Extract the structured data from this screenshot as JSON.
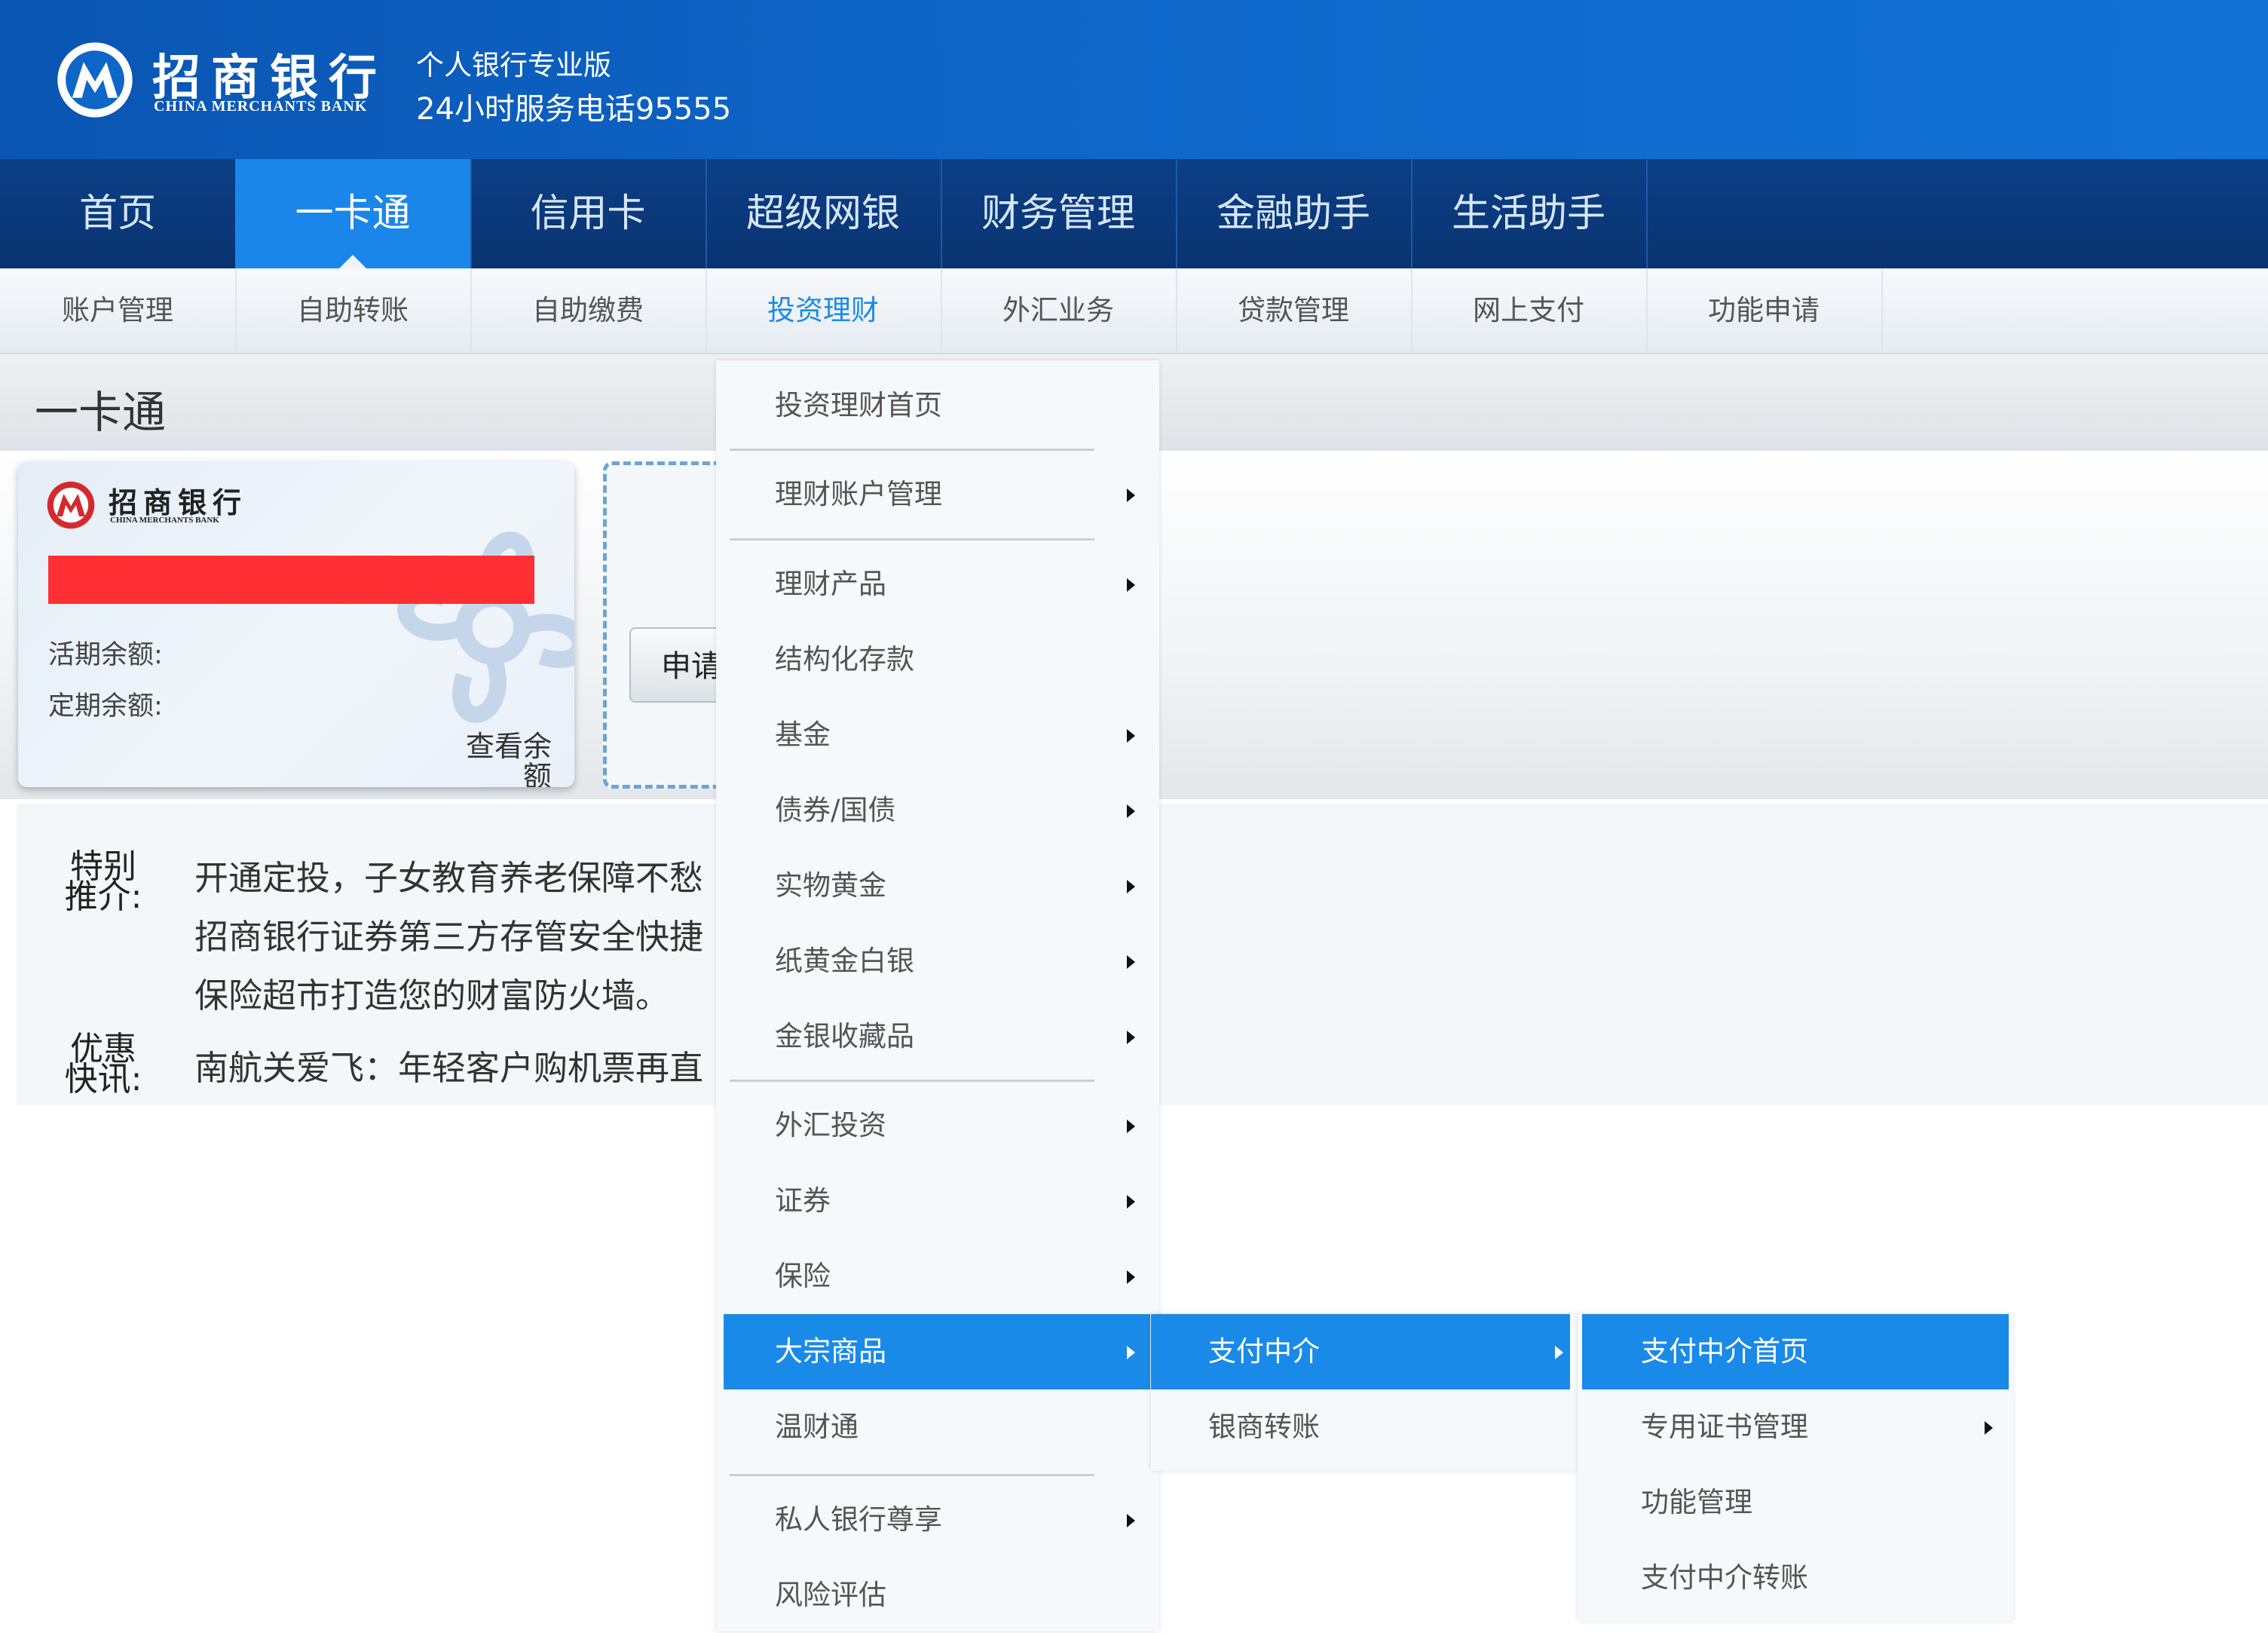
{
  "header": {
    "brand_cn": "招商银行",
    "brand_en": "CHINA MERCHANTS BANK",
    "edition": "个人银行专业版",
    "hotline": "24小时服务电话95555"
  },
  "main_nav": [
    "首页",
    "一卡通",
    "信用卡",
    "超级网银",
    "财务管理",
    "金融助手",
    "生活助手"
  ],
  "main_nav_active": "一卡通",
  "sub_nav": [
    "账户管理",
    "自助转账",
    "自助缴费",
    "投资理财",
    "外汇业务",
    "贷款管理",
    "网上支付",
    "功能申请"
  ],
  "sub_nav_active": "投资理财",
  "section_title": "一卡通",
  "card": {
    "brand_cn": "招商银行",
    "brand_en": "CHINA MERCHANTS BANK",
    "current_balance_label": "活期余额:",
    "fixed_balance_label": "定期余额:",
    "view_balance": "查看余额"
  },
  "apply_button": "申请",
  "promo": {
    "special_label": "特别推介:",
    "special_lines": [
      "开通定投，子女教育养老保障不愁",
      "招商银行证券第三方存管安全快捷",
      "保险超市打造您的财富防火墙。"
    ],
    "offer_label": "优惠快讯:",
    "offer_line": "南航关爱飞：年轻客户购机票再直"
  },
  "menu_level1": [
    {
      "label": "投资理财首页",
      "arrow": false
    },
    {
      "label": "理财账户管理",
      "arrow": true
    },
    {
      "label": "理财产品",
      "arrow": true
    },
    {
      "label": "结构化存款",
      "arrow": false
    },
    {
      "label": "基金",
      "arrow": true
    },
    {
      "label": "债券/国债",
      "arrow": true
    },
    {
      "label": "实物黄金",
      "arrow": true
    },
    {
      "label": "纸黄金白银",
      "arrow": true
    },
    {
      "label": "金银收藏品",
      "arrow": true
    },
    {
      "label": "外汇投资",
      "arrow": true
    },
    {
      "label": "证券",
      "arrow": true
    },
    {
      "label": "保险",
      "arrow": true
    },
    {
      "label": "大宗商品",
      "arrow": true,
      "highlighted": true
    },
    {
      "label": "温财通",
      "arrow": false
    },
    {
      "label": "私人银行尊享",
      "arrow": true
    },
    {
      "label": "风险评估",
      "arrow": false
    }
  ],
  "menu_level2": [
    {
      "label": "支付中介",
      "arrow": true,
      "highlighted": true
    },
    {
      "label": "银商转账",
      "arrow": false
    }
  ],
  "menu_level3": [
    {
      "label": "支付中介首页",
      "arrow": false,
      "highlighted": true
    },
    {
      "label": "专用证书管理",
      "arrow": true
    },
    {
      "label": "功能管理",
      "arrow": false
    },
    {
      "label": "支付中介转账",
      "arrow": false
    }
  ],
  "colors": {
    "header_blue": "#0e66c8",
    "nav_dark": "#0a3470",
    "active_blue": "#1a86ea",
    "redaction_red": "#ff2f33"
  }
}
